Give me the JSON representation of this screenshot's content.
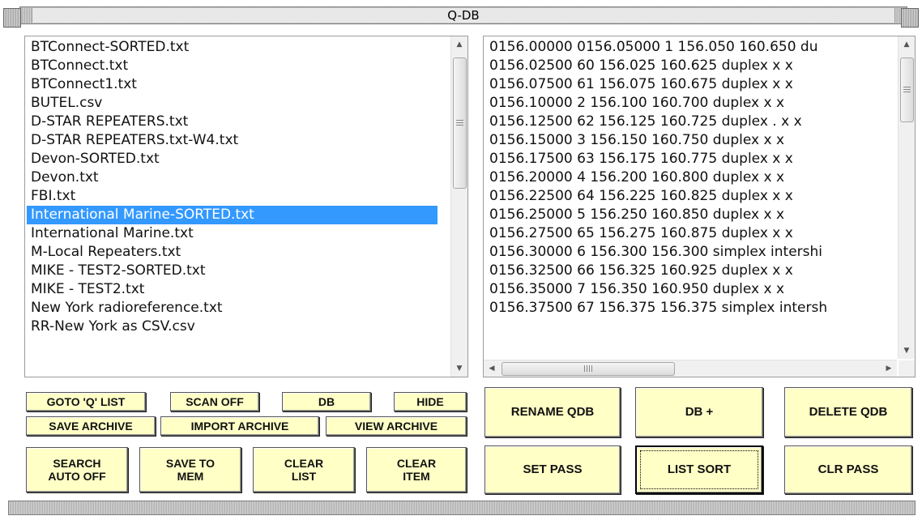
{
  "window": {
    "title": "Q-DB"
  },
  "left_list": {
    "items": [
      "BTConnect-SORTED.txt",
      "BTConnect.txt",
      "BTConnect1.txt",
      "BUTEL.csv",
      "D-STAR REPEATERS.txt",
      "D-STAR REPEATERS.txt-W4.txt",
      "Devon-SORTED.txt",
      "Devon.txt",
      "FBI.txt",
      "International Marine-SORTED.txt",
      "International Marine.txt",
      "M-Local Repeaters.txt",
      "MIKE - TEST2-SORTED.txt",
      "MIKE - TEST2.txt",
      "New York radioreference.txt",
      "RR-New York as CSV.csv"
    ],
    "selected": "International Marine-SORTED.txt"
  },
  "right_list": {
    "items": [
      "0156.00000 0156.05000 1 156.050 160.650 du",
      "0156.02500 60 156.025 160.625 duplex  x x",
      "0156.07500 61 156.075 160.675 duplex x x",
      "0156.10000 2 156.100 160.700 duplex x x",
      "0156.12500 62 156.125 160.725 duplex . x x",
      "0156.15000 3 156.150 160.750 duplex x x",
      "0156.17500 63 156.175 160.775 duplex x x",
      "0156.20000 4 156.200 160.800 duplex x x",
      "0156.22500 64 156.225 160.825 duplex x x",
      "0156.25000 5 156.250 160.850 duplex x x",
      "0156.27500 65 156.275 160.875 duplex x x",
      "0156.30000 6 156.300 156.300 simplex intershi",
      "0156.32500 66 156.325 160.925 duplex x x",
      "0156.35000 7 156.350 160.950 duplex x x",
      "0156.37500 67 156.375 156.375 simplex intersh"
    ]
  },
  "scrollbar": {
    "h_grip": "III"
  },
  "buttons": {
    "goto_q_list": "GOTO 'Q' LIST",
    "scan_off": "SCAN OFF",
    "db": "DB",
    "hide": "HIDE",
    "save_archive": "SAVE ARCHIVE",
    "import_archive": "IMPORT ARCHIVE",
    "view_archive": "VIEW ARCHIVE",
    "search_auto_off": "SEARCH\nAUTO OFF",
    "save_to_mem": "SAVE TO\nMEM",
    "clear_list": "CLEAR\nLIST",
    "clear_item": "CLEAR\nITEM",
    "rename_qdb": "RENAME QDB",
    "db_plus": "DB +",
    "delete_qdb": "DELETE QDB",
    "set_pass": "SET PASS",
    "list_sort": "LIST SORT",
    "clr_pass": "CLR PASS"
  },
  "colors": {
    "button_bg": "#ffffc6",
    "selection": "#3399ff"
  }
}
